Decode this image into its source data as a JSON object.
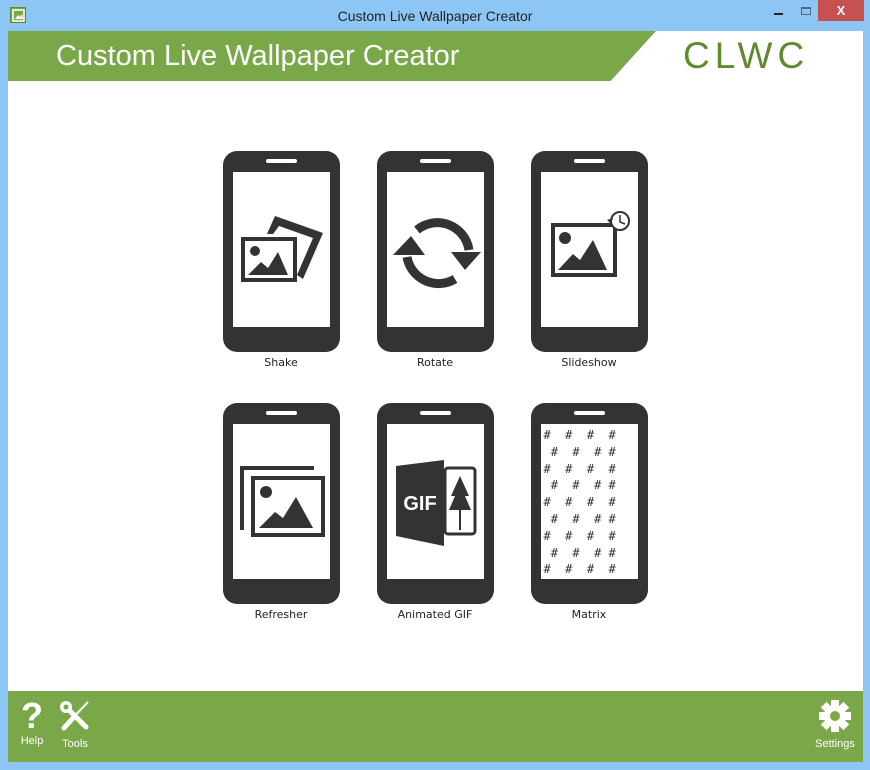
{
  "window": {
    "title": "Custom Live Wallpaper Creator",
    "controls": {
      "minimize": "minimize",
      "maximize": "maximize",
      "close": "X"
    }
  },
  "header": {
    "title": "Custom Live Wallpaper Creator",
    "logo": "CLWC",
    "accent_color": "#7aa848"
  },
  "tiles": [
    {
      "label": "Shake",
      "icon": "shake-pictures-icon"
    },
    {
      "label": "Rotate",
      "icon": "rotate-arrows-icon"
    },
    {
      "label": "Slideshow",
      "icon": "slideshow-picture-clock-icon"
    },
    {
      "label": "Refresher",
      "icon": "refresher-stacked-pictures-icon"
    },
    {
      "label": "Animated GIF",
      "icon": "gif-door-tree-icon",
      "icon_text": "GIF"
    },
    {
      "label": "Matrix",
      "icon": "matrix-hash-icon",
      "matrix_rows": [
        "#  #  #  #",
        " #  #  # #",
        "#  #  #  #",
        " #  #  # #",
        "#  #  #  #",
        " #  #  # #",
        "#  #  #  #",
        " #  #  # #",
        "#  #  #  #"
      ]
    }
  ],
  "footer": {
    "help_label": "Help",
    "tools_label": "Tools",
    "settings_label": "Settings",
    "help_glyph": "?"
  }
}
